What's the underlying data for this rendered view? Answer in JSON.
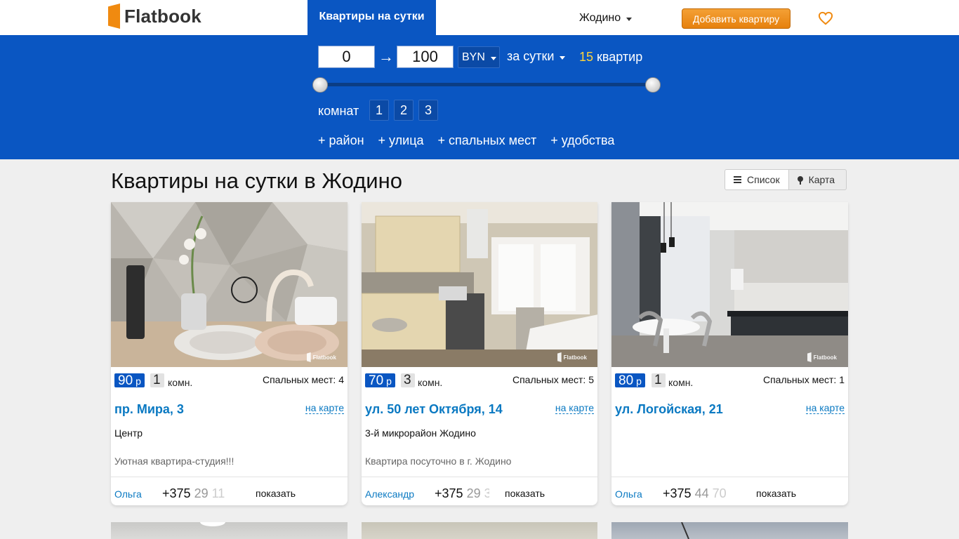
{
  "header": {
    "logo_text": "Flatbook",
    "nav_tab": "Квартиры на сутки",
    "city": "Жодино",
    "add_button": "Добавить квартиру",
    "brand_color": "#0a56c2",
    "accent_color": "#f08a10"
  },
  "filters": {
    "price_min": "0",
    "arrow": "→",
    "price_max": "100",
    "currency": "BYN",
    "period": "за сутки",
    "count_num": "15",
    "count_label": "квартир",
    "price_range_fraction": [
      0,
      1
    ],
    "rooms_label": "комнат",
    "rooms": [
      "1",
      "2",
      "3"
    ],
    "more": [
      "+ район",
      "+ улица",
      "+ спальных мест",
      "+ удобства"
    ]
  },
  "page": {
    "title": "Квартиры на сутки в Жодино",
    "view_list": "Список",
    "view_map": "Карта"
  },
  "cards": [
    {
      "price": "90",
      "currency": "р",
      "rooms": "1",
      "rooms_label": "комн.",
      "beds": "Спальных мест: 4",
      "address": "пр. Мира, 3",
      "map_link": "на карте",
      "district": "Центр",
      "description": "Уютная квартира-студия!!!",
      "owner": "Ольга",
      "phone_a": "+375",
      "phone_b": "29",
      "phone_c": "11",
      "show": "показать",
      "watermark": "Flatbook"
    },
    {
      "price": "70",
      "currency": "р",
      "rooms": "3",
      "rooms_label": "комн.",
      "beds": "Спальных мест: 5",
      "address": "ул. 50 лет Октября, 14",
      "map_link": "на карте",
      "district": "3-й микрорайон Жодино",
      "description": "Квартира посуточно в г. Жодино",
      "owner": "Александр",
      "phone_a": "+375",
      "phone_b": "29",
      "phone_c": "3",
      "show": "показать",
      "watermark": "Flatbook"
    },
    {
      "price": "80",
      "currency": "р",
      "rooms": "1",
      "rooms_label": "комн.",
      "beds": "Спальных мест: 1",
      "address": "ул. Логойская, 21",
      "map_link": "на карте",
      "district": "",
      "description": "",
      "owner": "Ольга",
      "phone_a": "+375",
      "phone_b": "44",
      "phone_c": "70",
      "show": "показать",
      "watermark": "Flatbook"
    }
  ]
}
